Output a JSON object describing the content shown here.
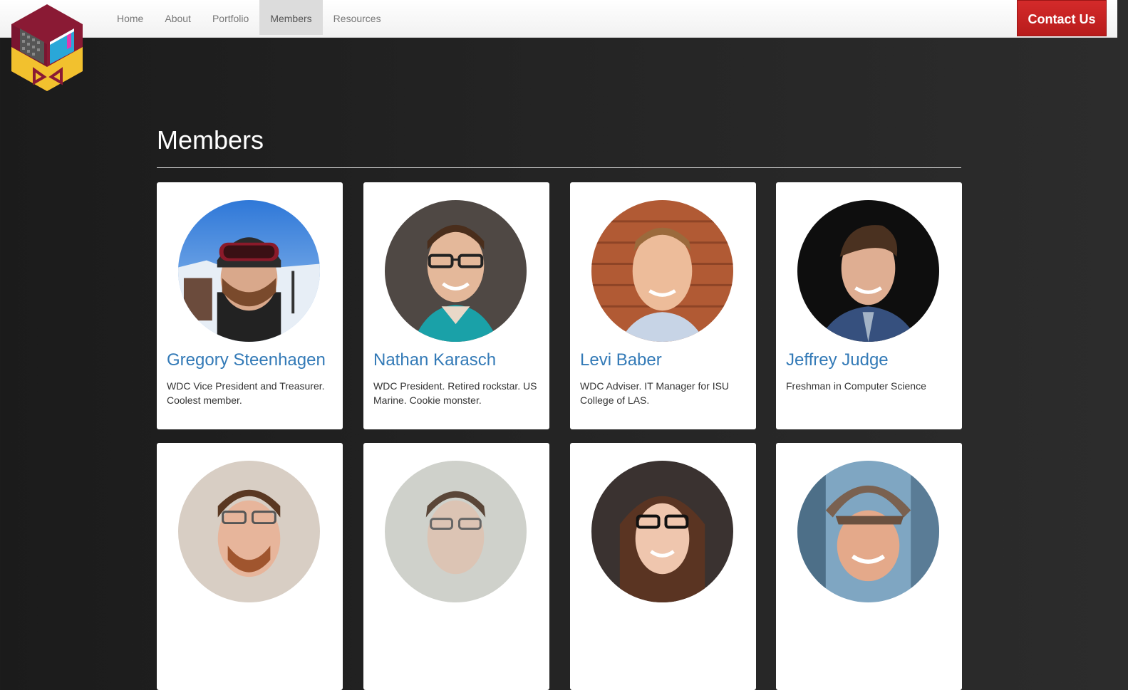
{
  "nav": {
    "items": [
      {
        "label": "Home",
        "active": false
      },
      {
        "label": "About",
        "active": false
      },
      {
        "label": "Portfolio",
        "active": false
      },
      {
        "label": "Members",
        "active": true
      },
      {
        "label": "Resources",
        "active": false
      }
    ],
    "contact_label": "Contact Us"
  },
  "page": {
    "title": "Members"
  },
  "members": [
    {
      "name": "Gregory Steenhagen",
      "bio": "WDC Vice President and Treasurer. Coolest member."
    },
    {
      "name": "Nathan Karasch",
      "bio": "WDC President. Retired rockstar. US Marine. Cookie monster."
    },
    {
      "name": "Levi Baber",
      "bio": "WDC Adviser. IT Manager for ISU College of LAS."
    },
    {
      "name": "Jeffrey Judge",
      "bio": "Freshman in Computer Science"
    },
    {
      "name": "",
      "bio": ""
    },
    {
      "name": "",
      "bio": ""
    },
    {
      "name": "",
      "bio": ""
    },
    {
      "name": "",
      "bio": ""
    }
  ],
  "colors": {
    "link": "#337ab7",
    "contact_button": "#c62222",
    "background": "#222222"
  }
}
